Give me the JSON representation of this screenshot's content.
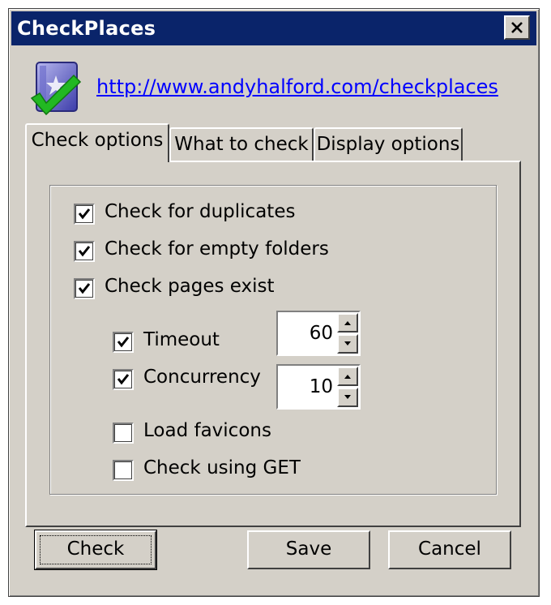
{
  "window": {
    "title": "CheckPlaces"
  },
  "header": {
    "link": "http://www.andyhalford.com/checkplaces"
  },
  "tabs": [
    {
      "label": "Check options",
      "active": true
    },
    {
      "label": "What to check",
      "active": false
    },
    {
      "label": "Display options",
      "active": false
    }
  ],
  "options": {
    "duplicates": {
      "label": "Check for duplicates",
      "checked": true
    },
    "empty_folders": {
      "label": "Check for empty folders",
      "checked": true
    },
    "pages_exist": {
      "label": "Check pages exist",
      "checked": true
    },
    "timeout": {
      "label": "Timeout",
      "checked": true,
      "value": "60"
    },
    "concurrency": {
      "label": "Concurrency",
      "checked": true,
      "value": "10"
    },
    "load_favicons": {
      "label": "Load favicons",
      "checked": false
    },
    "check_get": {
      "label": "Check using GET",
      "checked": false
    }
  },
  "buttons": {
    "check": "Check",
    "save": "Save",
    "cancel": "Cancel"
  },
  "colors": {
    "titlebar": "#0a246a",
    "face": "#d4d0c8",
    "link": "#0000ff",
    "check_green": "#22b822"
  }
}
